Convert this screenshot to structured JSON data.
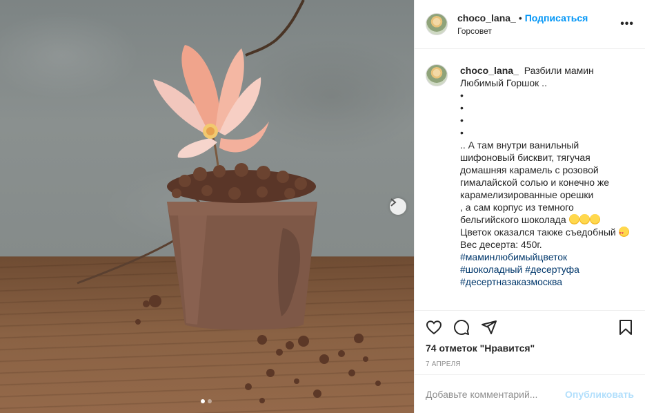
{
  "post": {
    "username": "choco_lana_",
    "separator": "•",
    "follow_label": "Подписаться",
    "location": "Горсовет",
    "more_label": "•••"
  },
  "caption": {
    "username": "choco_lana_",
    "text_first": "Разбили мамин Любимый Горшок ..",
    "bullets": [
      "•",
      "•",
      "•",
      "•"
    ],
    "line_1": ".. А там внутри ванильный шифоновый бисквит, тягучая домашняя карамель с розовой гималайской солью и конечно же карамелизированные орешки",
    "line_2": ", а сам корпус из темного бельгийского шоколада",
    "line_3": "Цветок оказался также съедобный",
    "line_4": "Вес десерта: 450г.",
    "hashtags": [
      "#маминлюбимыйцветок",
      "#шоколадный",
      "#десертуфа",
      "#десертназаказмосква"
    ]
  },
  "actions": {
    "likes": "74 отметок \"Нравится\"",
    "date": "7 апреля"
  },
  "comment_box": {
    "placeholder": "Добавьте комментарий...",
    "publish_label": "Опубликовать"
  },
  "carousel": {
    "slide_count": 2,
    "active_index": 0
  },
  "icons": {
    "like": "heart-icon",
    "comment": "comment-icon",
    "share": "share-icon",
    "save": "bookmark-icon",
    "next": "chevron-right-icon"
  },
  "colors": {
    "accent": "#0095f6",
    "hashtag": "#00376b",
    "publish_disabled": "#b2dffc",
    "muted": "#8e8e8e"
  }
}
